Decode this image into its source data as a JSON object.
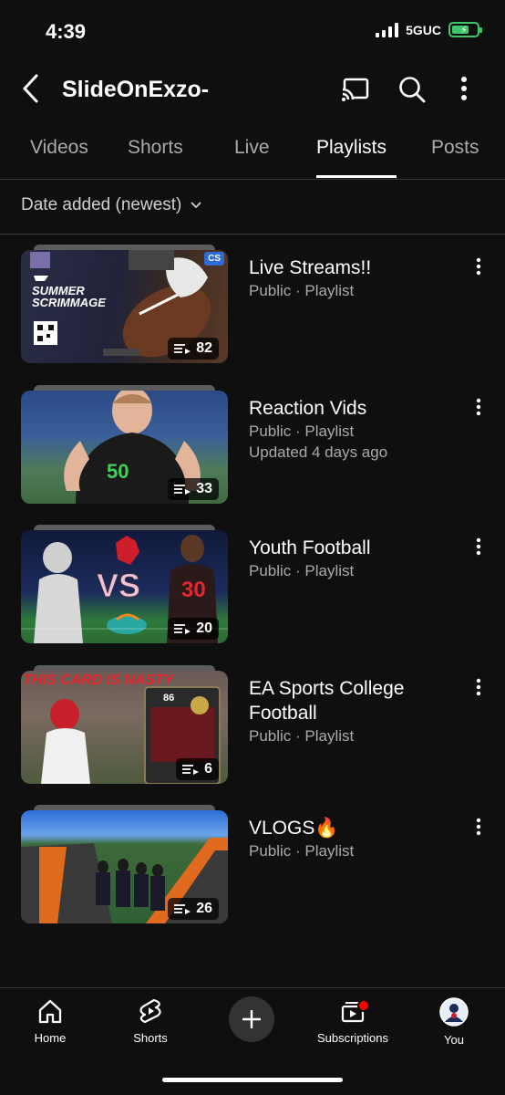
{
  "status": {
    "time": "4:39",
    "network": "5GUC"
  },
  "header": {
    "title": "SlideOnExzo-",
    "back_icon": "back-arrow-icon",
    "cast_icon": "cast-icon",
    "search_icon": "search-icon",
    "more_icon": "more-vertical-icon"
  },
  "tabs": [
    {
      "label": "Videos"
    },
    {
      "label": "Shorts"
    },
    {
      "label": "Live"
    },
    {
      "label": "Playlists",
      "active": true
    },
    {
      "label": "Posts"
    }
  ],
  "sort": {
    "label": "Date added (newest)"
  },
  "playlists": [
    {
      "title": "Live Streams!!",
      "meta1": "Public · Playlist",
      "meta2": "",
      "count": "82",
      "thumb_text": {
        "t1": "SUMMER",
        "t2": "SCRIMMAGE",
        "badge": "CS"
      }
    },
    {
      "title": "Reaction Vids",
      "meta1": "Public · Playlist",
      "meta2": "Updated 4 days ago",
      "count": "33",
      "thumb_text": {
        "jersey": "50"
      }
    },
    {
      "title": "Youth Football",
      "meta1": "Public · Playlist",
      "meta2": "",
      "count": "20",
      "thumb_text": {
        "vs": "VS",
        "jersey": "30"
      }
    },
    {
      "title": "EA Sports College Football",
      "meta1": "Public · Playlist",
      "meta2": "",
      "count": "6",
      "thumb_text": {
        "headline": "THIS CARD IS NASTY",
        "rating": "86"
      }
    },
    {
      "title": "VLOGS🔥",
      "meta1": "Public · Playlist",
      "meta2": "",
      "count": "26",
      "thumb_text": {}
    }
  ],
  "nav": [
    {
      "label": "Home",
      "icon": "home-icon"
    },
    {
      "label": "Shorts",
      "icon": "shorts-icon"
    },
    {
      "label": "",
      "icon": "create-plus-icon"
    },
    {
      "label": "Subscriptions",
      "icon": "subscriptions-icon"
    },
    {
      "label": "You",
      "icon": "avatar-icon"
    }
  ],
  "colors": {
    "background": "#0f0f0f",
    "text": "#f1f1f1",
    "secondary": "#aaaaaa",
    "notification": "#ff0000"
  }
}
